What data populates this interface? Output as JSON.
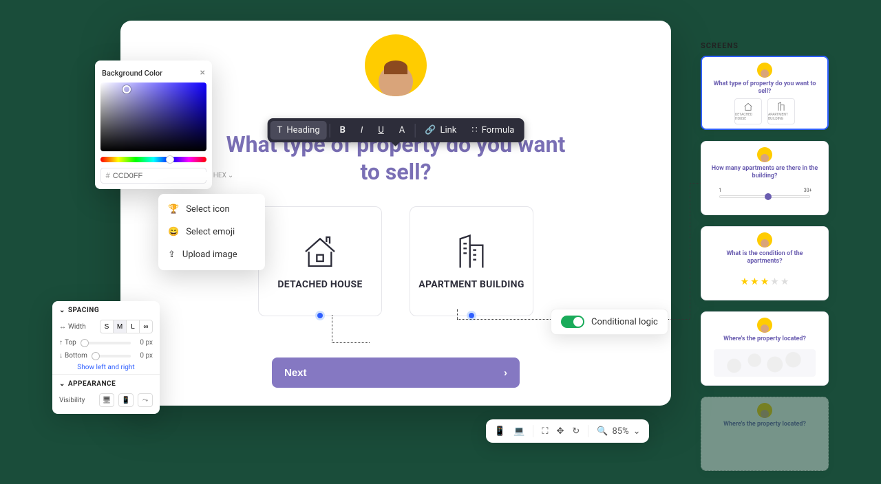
{
  "screensLabel": "SCREENS",
  "main": {
    "question": "What type of property do you want to sell?",
    "options": [
      {
        "label": "DETACHED HOUSE"
      },
      {
        "label": "APARTMENT BUILDING"
      }
    ],
    "nextLabel": "Next"
  },
  "formatToolbar": {
    "heading": "Heading",
    "link": "Link",
    "formula": "Formula"
  },
  "colorPopover": {
    "title": "Background Color",
    "hexValue": "CCD0FF",
    "hexMode": "HEX"
  },
  "iconMenu": {
    "selectIcon": "Select icon",
    "selectEmoji": "Select emoji",
    "uploadImage": "Upload image"
  },
  "spacingPanel": {
    "spacingTitle": "SPACING",
    "widthLabel": "Width",
    "widthOptions": [
      "S",
      "M",
      "L",
      "∞"
    ],
    "widthSelected": "M",
    "topLabel": "Top",
    "topValue": "0 px",
    "bottomLabel": "Bottom",
    "bottomValue": "0 px",
    "showLR": "Show left and right",
    "appearanceTitle": "APPEARANCE",
    "visibilityLabel": "Visibility"
  },
  "conditionalLogic": {
    "label": "Conditional logic",
    "enabled": true
  },
  "zoomToolbar": {
    "zoom": "85%"
  },
  "screens": [
    {
      "title": "What type of property do you want to sell?",
      "kind": "options",
      "cards": [
        "DETACHED HOUSE",
        "APARTMENT BUILDING"
      ],
      "selected": true
    },
    {
      "title": "How many apartments are there in the building?",
      "kind": "slider",
      "min": "1",
      "max": "30+"
    },
    {
      "title": "What is the condition of the apartments?",
      "kind": "stars",
      "rating": 3,
      "outOf": 5
    },
    {
      "title": "Where's the property located?",
      "kind": "map"
    },
    {
      "title": "Where's the property located?",
      "kind": "ghost"
    }
  ]
}
